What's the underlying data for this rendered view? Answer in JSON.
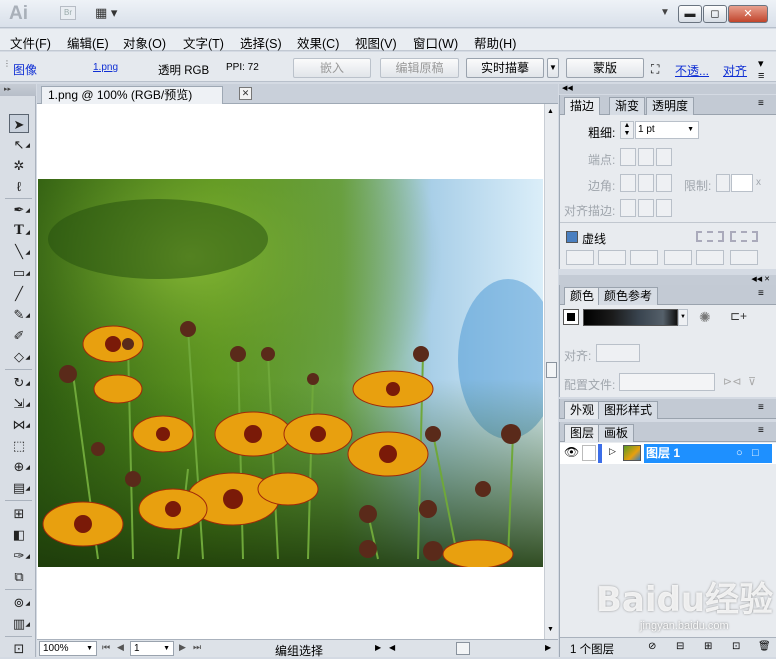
{
  "app": {
    "logo": "Ai",
    "bridge": "Br",
    "arrange": "▦ ▾"
  },
  "window": {
    "minimize": "▬",
    "maximize": "◻",
    "close": "✕"
  },
  "menu": [
    "文件(F)",
    "编辑(E)",
    "对象(O)",
    "文字(T)",
    "选择(S)",
    "效果(C)",
    "视图(V)",
    "窗口(W)",
    "帮助(H)"
  ],
  "control": {
    "selection_type": "图像",
    "file_link": "1.png",
    "color_mode": "透明 RGB",
    "ppi": "PPI: 72",
    "embed": "嵌入",
    "edit_original": "编辑原稿",
    "live_trace": "实时描摹",
    "mask": "蒙版",
    "opacity_link": "不透...",
    "align_link": "对齐"
  },
  "document": {
    "tab_title": "1.png @ 100% (RGB/预览)",
    "zoom": "100%",
    "artboard": "1",
    "status": "编组选择"
  },
  "stroke_panel": {
    "tabs": [
      "描边",
      "渐变",
      "透明度"
    ],
    "weight_label": "粗细:",
    "weight_value": "1 pt",
    "cap_label": "端点:",
    "corner_label": "边角:",
    "limit_label": "限制:",
    "limit_suffix": "x",
    "align_label": "对齐描边:",
    "dashed_label": "虚线"
  },
  "color_panel": {
    "tabs": [
      "颜色",
      "颜色参考"
    ]
  },
  "align_panel": {
    "align_label": "对齐:",
    "profile_label": "配置文件:"
  },
  "appearance_panel": {
    "tabs": [
      "外观",
      "图形样式"
    ]
  },
  "layers_panel": {
    "tabs": [
      "图层",
      "画板"
    ],
    "layer_name": "图层 1",
    "footer_count": "1 个图层"
  },
  "watermark": {
    "main": "Baidu经验",
    "sub": "jingyan.baidu.com"
  },
  "colors": {
    "accent": "#1e90ff",
    "link": "#0f2fd4"
  }
}
